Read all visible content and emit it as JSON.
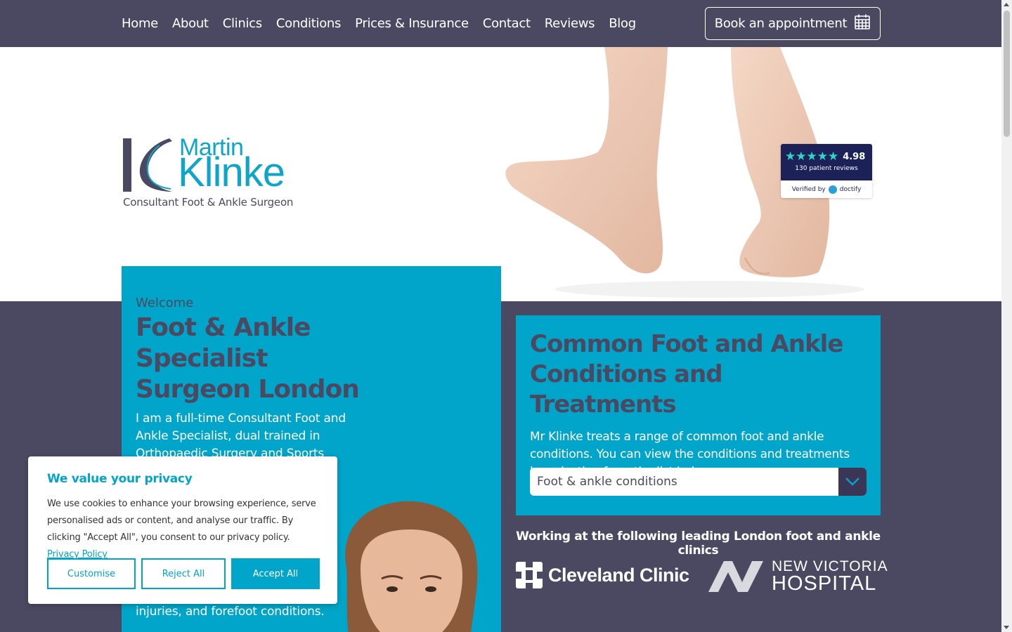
{
  "nav": {
    "items": [
      "Home",
      "About",
      "Clinics",
      "Conditions",
      "Prices & Insurance",
      "Contact",
      "Reviews",
      "Blog"
    ],
    "book_label": "Book an appointment"
  },
  "logo": {
    "first": "Martin",
    "last": "Klinke",
    "tagline": "Consultant Foot & Ankle Surgeon"
  },
  "rating": {
    "score": "4.98",
    "stars": "★★★★★",
    "count": "130 patient reviews",
    "verified": "Verified by",
    "brand": "doctify"
  },
  "welcome": {
    "kicker": "Welcome",
    "title": "Foot & Ankle Specialist Surgeon London",
    "body": "I am a full-time Consultant Foot and Ankle Specialist, dual trained in Orthopaedic Surgery and Sports",
    "tail": "injuries, and forefoot conditions."
  },
  "conditions": {
    "title": "Common Foot and Ankle Conditions and Treatments",
    "body": "Mr Klinke treats a range of common foot and ankle conditions. You can view the conditions and treatments by selecting from the list below.",
    "select_value": "Foot & ankle conditions"
  },
  "clinics": {
    "heading": "Working at the following leading London foot and ankle clinics",
    "cleveland": "Cleveland Clinic",
    "nvh_line1": "NEW VICTORIA",
    "nvh_line2": "HOSPITAL"
  },
  "cookie": {
    "title": "We value your privacy",
    "body": "We use cookies to enhance your browsing experience, serve personalised ads or content, and analyse our traffic. By clicking \"Accept All\", you consent to our privacy policy.",
    "link": "Privacy Policy",
    "customise": "Customise",
    "reject": "Reject All",
    "accept": "Accept All"
  },
  "colors": {
    "brand_dark": "#4b4962",
    "brand_teal": "#01a5c9",
    "doctify_navy": "#1c2157"
  }
}
